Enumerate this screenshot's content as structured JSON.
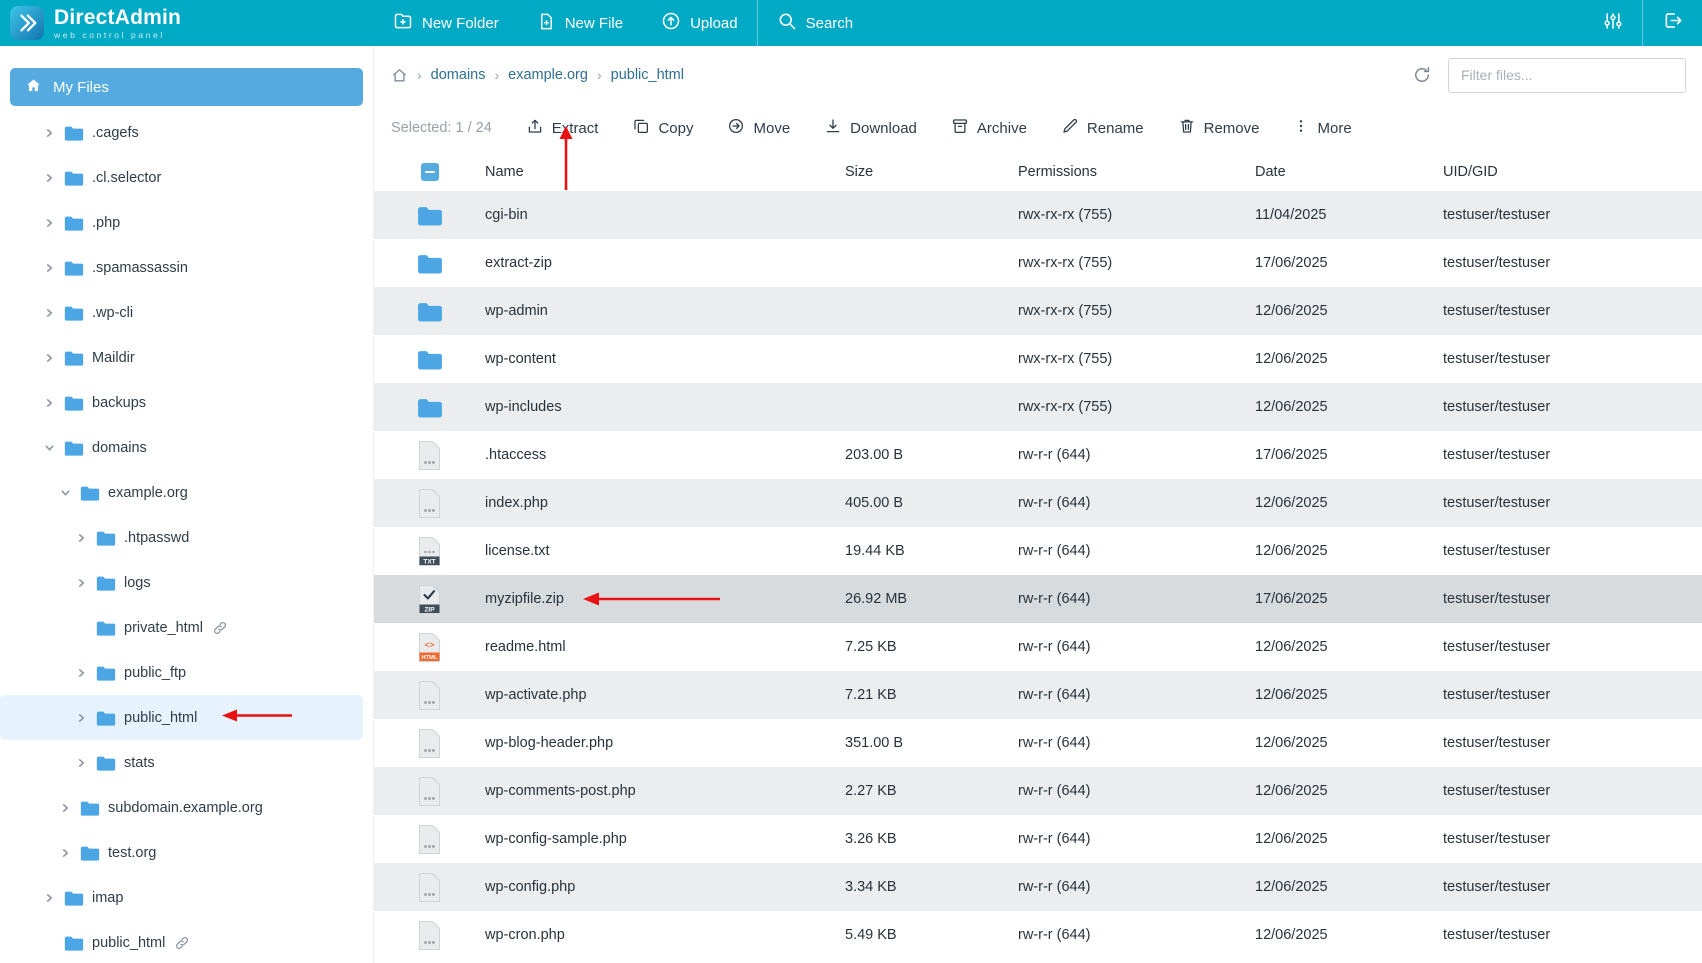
{
  "brand": {
    "title": "DirectAdmin",
    "subtitle": "web control panel"
  },
  "topbar": {
    "actions": [
      {
        "id": "new-folder",
        "label": "New Folder"
      },
      {
        "id": "new-file",
        "label": "New File"
      },
      {
        "id": "upload",
        "label": "Upload"
      },
      {
        "id": "search",
        "label": "Search"
      }
    ]
  },
  "sidebar": {
    "title": "My Files",
    "tree": [
      {
        "label": ".cagefs",
        "level": 0,
        "expandable": true,
        "expanded": false
      },
      {
        "label": ".cl.selector",
        "level": 0,
        "expandable": true,
        "expanded": false
      },
      {
        "label": ".php",
        "level": 0,
        "expandable": true,
        "expanded": false
      },
      {
        "label": ".spamassassin",
        "level": 0,
        "expandable": true,
        "expanded": false
      },
      {
        "label": ".wp-cli",
        "level": 0,
        "expandable": true,
        "expanded": false
      },
      {
        "label": "Maildir",
        "level": 0,
        "expandable": true,
        "expanded": false
      },
      {
        "label": "backups",
        "level": 0,
        "expandable": true,
        "expanded": false
      },
      {
        "label": "domains",
        "level": 0,
        "expandable": true,
        "expanded": true
      },
      {
        "label": "example.org",
        "level": 1,
        "expandable": true,
        "expanded": true
      },
      {
        "label": ".htpasswd",
        "level": 2,
        "expandable": true,
        "expanded": false
      },
      {
        "label": "logs",
        "level": 2,
        "expandable": true,
        "expanded": false
      },
      {
        "label": "private_html",
        "level": 2,
        "expandable": false,
        "link": true
      },
      {
        "label": "public_ftp",
        "level": 2,
        "expandable": true,
        "expanded": false
      },
      {
        "label": "public_html",
        "level": 2,
        "expandable": true,
        "expanded": false,
        "selected": true
      },
      {
        "label": "stats",
        "level": 2,
        "expandable": true,
        "expanded": false
      },
      {
        "label": "subdomain.example.org",
        "level": 1,
        "expandable": true,
        "expanded": false
      },
      {
        "label": "test.org",
        "level": 1,
        "expandable": true,
        "expanded": false
      },
      {
        "label": "imap",
        "level": 0,
        "expandable": true,
        "expanded": false
      },
      {
        "label": "public_html",
        "level": 0,
        "expandable": false,
        "link": true
      }
    ]
  },
  "pathbar": {
    "breadcrumb": [
      "domains",
      "example.org",
      "public_html"
    ],
    "filter_placeholder": "Filter files..."
  },
  "toolbar": {
    "selected_label": "Selected: 1 / 24",
    "buttons": [
      {
        "id": "extract",
        "label": "Extract"
      },
      {
        "id": "copy",
        "label": "Copy"
      },
      {
        "id": "move",
        "label": "Move"
      },
      {
        "id": "download",
        "label": "Download"
      },
      {
        "id": "archive",
        "label": "Archive"
      },
      {
        "id": "rename",
        "label": "Rename"
      },
      {
        "id": "remove",
        "label": "Remove"
      },
      {
        "id": "more",
        "label": "More"
      }
    ]
  },
  "table": {
    "headers": {
      "name": "Name",
      "size": "Size",
      "permissions": "Permissions",
      "date": "Date",
      "uid": "UID/GID"
    },
    "rows": [
      {
        "name": "cgi-bin",
        "icon": "folder",
        "size": "",
        "permissions": "rwx-rx-rx (755)",
        "date": "11/04/2025",
        "uid": "testuser/testuser"
      },
      {
        "name": "extract-zip",
        "icon": "folder",
        "size": "",
        "permissions": "rwx-rx-rx (755)",
        "date": "17/06/2025",
        "uid": "testuser/testuser"
      },
      {
        "name": "wp-admin",
        "icon": "folder",
        "size": "",
        "permissions": "rwx-rx-rx (755)",
        "date": "12/06/2025",
        "uid": "testuser/testuser"
      },
      {
        "name": "wp-content",
        "icon": "folder",
        "size": "",
        "permissions": "rwx-rx-rx (755)",
        "date": "12/06/2025",
        "uid": "testuser/testuser"
      },
      {
        "name": "wp-includes",
        "icon": "folder",
        "size": "",
        "permissions": "rwx-rx-rx (755)",
        "date": "12/06/2025",
        "uid": "testuser/testuser"
      },
      {
        "name": ".htaccess",
        "icon": "file",
        "size": "203.00 B",
        "permissions": "rw-r-r (644)",
        "date": "17/06/2025",
        "uid": "testuser/testuser"
      },
      {
        "name": "index.php",
        "icon": "file",
        "size": "405.00 B",
        "permissions": "rw-r-r (644)",
        "date": "12/06/2025",
        "uid": "testuser/testuser"
      },
      {
        "name": "license.txt",
        "icon": "txt",
        "size": "19.44 KB",
        "permissions": "rw-r-r (644)",
        "date": "12/06/2025",
        "uid": "testuser/testuser"
      },
      {
        "name": "myzipfile.zip",
        "icon": "zip",
        "size": "26.92 MB",
        "permissions": "rw-r-r (644)",
        "date": "17/06/2025",
        "uid": "testuser/testuser",
        "selected": true
      },
      {
        "name": "readme.html",
        "icon": "html",
        "size": "7.25 KB",
        "permissions": "rw-r-r (644)",
        "date": "12/06/2025",
        "uid": "testuser/testuser"
      },
      {
        "name": "wp-activate.php",
        "icon": "file",
        "size": "7.21 KB",
        "permissions": "rw-r-r (644)",
        "date": "12/06/2025",
        "uid": "testuser/testuser"
      },
      {
        "name": "wp-blog-header.php",
        "icon": "file",
        "size": "351.00 B",
        "permissions": "rw-r-r (644)",
        "date": "12/06/2025",
        "uid": "testuser/testuser"
      },
      {
        "name": "wp-comments-post.php",
        "icon": "file",
        "size": "2.27 KB",
        "permissions": "rw-r-r (644)",
        "date": "12/06/2025",
        "uid": "testuser/testuser"
      },
      {
        "name": "wp-config-sample.php",
        "icon": "file",
        "size": "3.26 KB",
        "permissions": "rw-r-r (644)",
        "date": "12/06/2025",
        "uid": "testuser/testuser"
      },
      {
        "name": "wp-config.php",
        "icon": "file",
        "size": "3.34 KB",
        "permissions": "rw-r-r (644)",
        "date": "12/06/2025",
        "uid": "testuser/testuser"
      },
      {
        "name": "wp-cron.php",
        "icon": "file",
        "size": "5.49 KB",
        "permissions": "rw-r-r (644)",
        "date": "12/06/2025",
        "uid": "testuser/testuser"
      }
    ]
  },
  "colors": {
    "topbar": "#00a9c4",
    "accent_blue": "#55abdf",
    "folder_blue": "#4ba6e3",
    "row_stripe": "#ebedee",
    "row_selected": "#d8dbdd",
    "annotation_arrow": "#e81212",
    "html_icon_orange": "#f26a2e"
  }
}
